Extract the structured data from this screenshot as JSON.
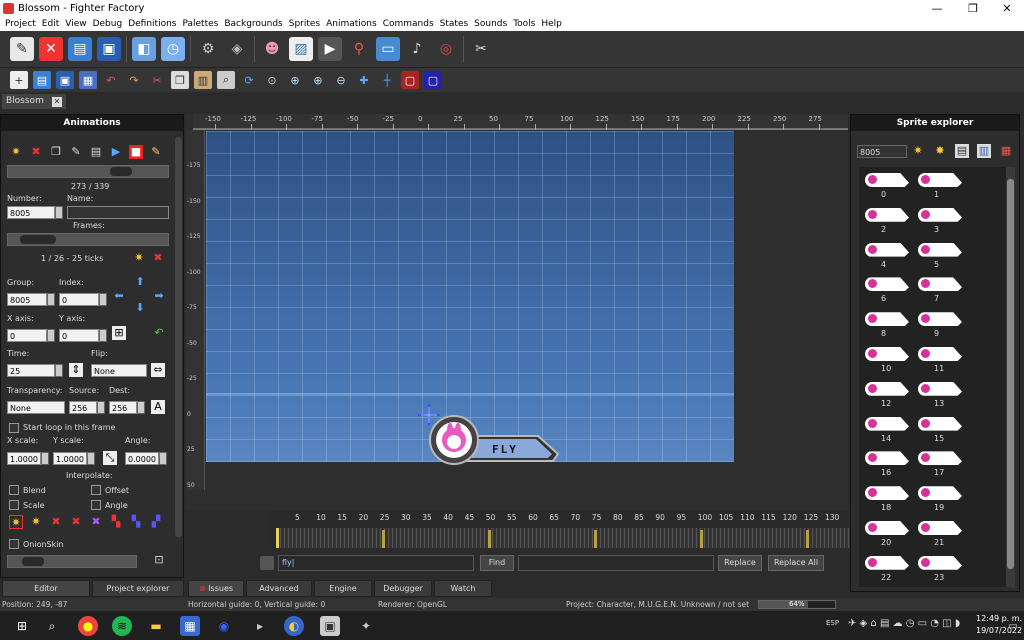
{
  "window": {
    "title": "Blossom - Fighter Factory",
    "min": "—",
    "max": "❐",
    "close": "✕"
  },
  "menu": [
    "Project",
    "Edit",
    "View",
    "Debug",
    "Definitions",
    "Palettes",
    "Backgrounds",
    "Sprites",
    "Animations",
    "Commands",
    "States",
    "Sounds",
    "Tools",
    "Help"
  ],
  "doc_tab": {
    "label": "Blossom",
    "close": "✕"
  },
  "animations": {
    "title": "Animations",
    "counter": "273 / 339",
    "number_label": "Number:",
    "name_label": "Name:",
    "number": "8005",
    "name": "",
    "frames_label": "Frames:",
    "frame_info": "1 / 26 - 25 ticks",
    "group_label": "Group:",
    "index_label": "Index:",
    "group": "8005",
    "index": "0",
    "xaxis_label": "X axis:",
    "yaxis_label": "Y axis:",
    "xaxis": "0",
    "yaxis": "0",
    "time_label": "Time:",
    "flip_label": "Flip:",
    "time": "25",
    "flip": "None",
    "transparency_label": "Transparency:",
    "source_label": "Source:",
    "dest_label": "Dest:",
    "transparency": "None",
    "source": "256",
    "dest": "256",
    "start_loop": "Start loop in this frame",
    "xscale_label": "X scale:",
    "yscale_label": "Y scale:",
    "angle_label": "Angle:",
    "xscale": "1.0000",
    "yscale": "1.0000",
    "angle": "0.0000",
    "interpolate_label": "Interpolate:",
    "blend": "Blend",
    "offset": "Offset",
    "scale": "Scale",
    "angle_chk": "Angle",
    "onionskin": "OnionSkin"
  },
  "ruler_top": [
    "-150",
    "-125",
    "-100",
    "-75",
    "-50",
    "-25",
    "0",
    "25",
    "50",
    "75",
    "100",
    "125",
    "150",
    "175",
    "200",
    "225",
    "250",
    "275"
  ],
  "ruler_left": [
    "-175",
    "-150",
    "-125",
    "-100",
    "-75",
    "-50",
    "-25",
    "0",
    "25",
    "50"
  ],
  "fly_label": "FLY",
  "timeline_ticks": [
    "5",
    "10",
    "15",
    "20",
    "25",
    "30",
    "35",
    "40",
    "45",
    "50",
    "55",
    "60",
    "65",
    "70",
    "75",
    "80",
    "85",
    "90",
    "95",
    "100",
    "105",
    "110",
    "115",
    "120",
    "125",
    "130"
  ],
  "find": {
    "value": "fly|",
    "find_btn": "Find",
    "replace_btn": "Replace",
    "replace_all_btn": "Replace All"
  },
  "sprite_explorer": {
    "title": "Sprite explorer",
    "group": "8005",
    "items": [
      "0",
      "1",
      "2",
      "3",
      "4",
      "5",
      "6",
      "7",
      "8",
      "9",
      "10",
      "11",
      "12",
      "13",
      "14",
      "15",
      "16",
      "17",
      "18",
      "19",
      "20",
      "21",
      "22",
      "23"
    ]
  },
  "bottom_tabs": {
    "editor": "Editor",
    "project_explorer": "Project explorer",
    "issues": "Issues",
    "advanced_search": "Advanced Search",
    "engine_output": "Engine Output",
    "debugger": "Debugger",
    "watch": "Watch"
  },
  "status": {
    "position": "Position: 249, -87",
    "guides": "Horizontal guide: 0, Vertical guide: 0",
    "renderer": "Renderer: OpenGL",
    "project": "Project: Character, M.U.G.E.N. Unknown / not set",
    "progress": "64%",
    "progress_value": 0.64
  },
  "taskbar": {
    "lang": "ESP",
    "time": "12:49 p. m.",
    "date": "19/07/2022"
  }
}
